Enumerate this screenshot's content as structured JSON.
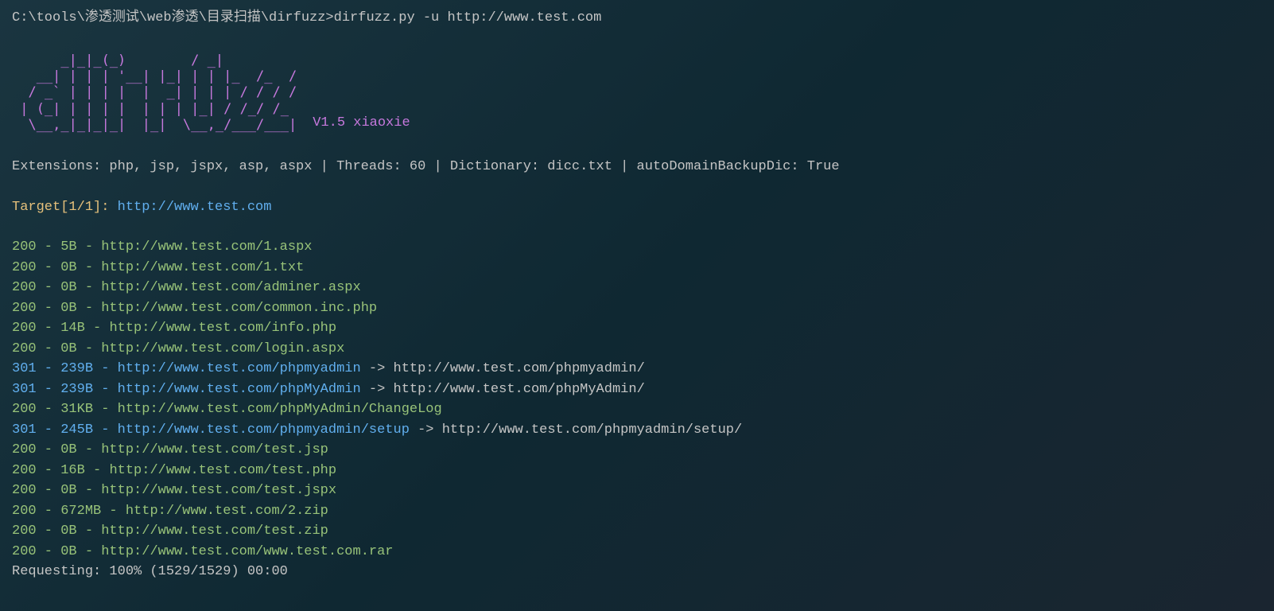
{
  "command_line": "C:\\tools\\渗透测试\\web渗透\\目录扫描\\dirfuzz>dirfuzz.py -u http://www.test.com",
  "ascii_art": "      _|_|_(_)        / _|\n    __| | | | '__| |_| | | |_  /_  /\n  / _` | | |  __|  _| | | |/ / / /\n | (_| | | | |  | | | |_| / /_/ /_\n  \\__,_| |_|_|  |_|  \\__,_/___/___|",
  "ascii_lines": [
    "      _|_|_(_)        / _|",
    "   __| | | | '__| |_| | | |_  /_  /",
    "  / _` | | | |  |  _| | | | / / / /",
    " | (_| | | | |  | | | |_| / /_/ /_",
    "  \\__,_|_|_|_|  |_|  \\__,_/___/___|"
  ],
  "version": "V1.5 xiaoxie",
  "config": "Extensions: php, jsp, jspx, asp, aspx | Threads: 60 | Dictionary: dicc.txt | autoDomainBackupDic: True",
  "target": {
    "label": "Target[1/1]: ",
    "url": "http://www.test.com"
  },
  "results": [
    {
      "status": "200",
      "size": "5B",
      "url": "http://www.test.com/1.aspx",
      "redirect": null
    },
    {
      "status": "200",
      "size": "0B",
      "url": "http://www.test.com/1.txt",
      "redirect": null
    },
    {
      "status": "200",
      "size": "0B",
      "url": "http://www.test.com/adminer.aspx",
      "redirect": null
    },
    {
      "status": "200",
      "size": "0B",
      "url": "http://www.test.com/common.inc.php",
      "redirect": null
    },
    {
      "status": "200",
      "size": "14B",
      "url": "http://www.test.com/info.php",
      "redirect": null
    },
    {
      "status": "200",
      "size": "0B",
      "url": "http://www.test.com/login.aspx",
      "redirect": null
    },
    {
      "status": "301",
      "size": "239B",
      "url": "http://www.test.com/phpmyadmin",
      "redirect": "http://www.test.com/phpmyadmin/"
    },
    {
      "status": "301",
      "size": "239B",
      "url": "http://www.test.com/phpMyAdmin",
      "redirect": "http://www.test.com/phpMyAdmin/"
    },
    {
      "status": "200",
      "size": "31KB",
      "url": "http://www.test.com/phpMyAdmin/ChangeLog",
      "redirect": null
    },
    {
      "status": "301",
      "size": "245B",
      "url": "http://www.test.com/phpmyadmin/setup",
      "redirect": "http://www.test.com/phpmyadmin/setup/"
    },
    {
      "status": "200",
      "size": "0B",
      "url": "http://www.test.com/test.jsp",
      "redirect": null
    },
    {
      "status": "200",
      "size": "16B",
      "url": "http://www.test.com/test.php",
      "redirect": null
    },
    {
      "status": "200",
      "size": "0B",
      "url": "http://www.test.com/test.jspx",
      "redirect": null
    },
    {
      "status": "200",
      "size": "672MB",
      "url": "http://www.test.com/2.zip",
      "redirect": null
    },
    {
      "status": "200",
      "size": "0B",
      "url": "http://www.test.com/test.zip",
      "redirect": null
    },
    {
      "status": "200",
      "size": "0B",
      "url": "http://www.test.com/www.test.com.rar",
      "redirect": null
    }
  ],
  "requesting": "Requesting: 100% (1529/1529) 00:00"
}
